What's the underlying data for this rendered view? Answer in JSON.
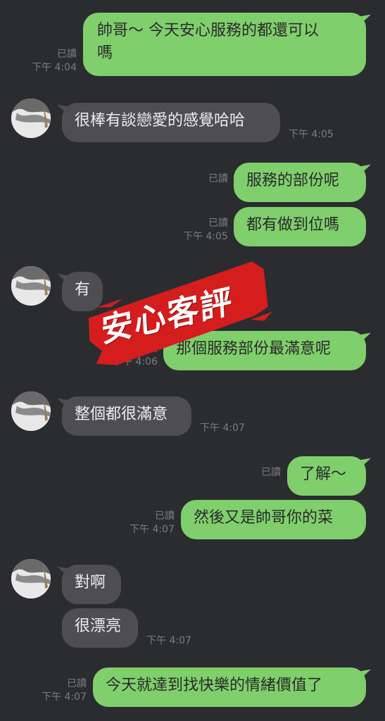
{
  "messages": [
    {
      "dir": "out",
      "text_line1": "帥哥～ 今天安心服務的都還可以",
      "text_line2": "嗎",
      "read": "已讀",
      "time": "下午 4:04"
    },
    {
      "dir": "in",
      "text": "很棒有談戀愛的感覺哈哈",
      "time": "下午 4:05"
    },
    {
      "dir": "out",
      "text": "服務的部份呢",
      "read": "已讀"
    },
    {
      "dir": "out",
      "text": "都有做到位嗎",
      "read": "已讀",
      "time": "下午 4:05"
    },
    {
      "dir": "in",
      "text": "有"
    },
    {
      "dir": "out",
      "text": "那個服務部份最滿意呢",
      "read": "已讀",
      "time": "下午 4:06"
    },
    {
      "dir": "in",
      "text": "整個都很滿意",
      "time": "下午 4:07"
    },
    {
      "dir": "out",
      "text": "了解～",
      "read": "已讀"
    },
    {
      "dir": "out",
      "text": "然後又是帥哥你的菜",
      "read": "已讀",
      "time": "下午 4:07"
    },
    {
      "dir": "in",
      "text": "對啊"
    },
    {
      "dir": "in",
      "text": "很漂亮",
      "time": "下午 4:07"
    },
    {
      "dir": "out",
      "text": "今天就達到找快樂的情緒價值了",
      "read": "已讀",
      "time": "下午 4:07"
    }
  ],
  "watermark": {
    "text": "安心客評",
    "color": "#d51d1d"
  },
  "colors": {
    "background": "#2b2c30",
    "outgoing": "#7fcf6d",
    "incoming": "#4d4d52",
    "meta": "#7c7d82"
  }
}
